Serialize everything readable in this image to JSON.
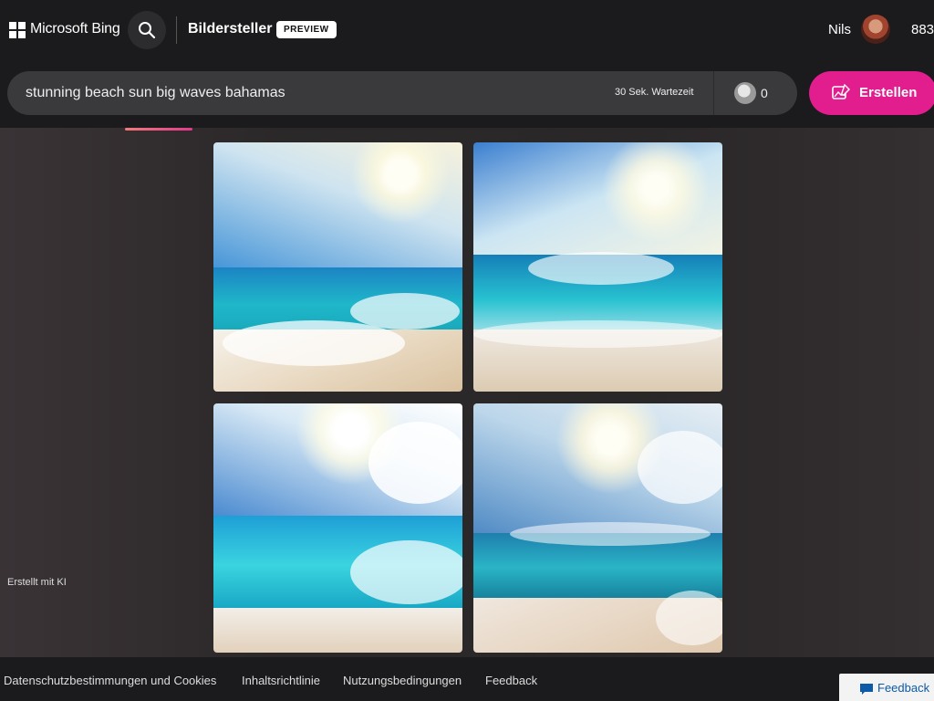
{
  "header": {
    "brand": "Microsoft Bing",
    "product": "Bildersteller",
    "badge": "PREVIEW",
    "user_name": "Nils",
    "points": "883"
  },
  "prompt_bar": {
    "query": "stunning beach sun big waves bahamas",
    "wait_text": "30 Sek. Wartezeit",
    "boost_count": "0",
    "create_label": "Erstellen"
  },
  "side": {
    "created_label": "Erstellt mit KI"
  },
  "images": [
    {
      "name": "generated-image-1"
    },
    {
      "name": "generated-image-2"
    },
    {
      "name": "generated-image-3"
    },
    {
      "name": "generated-image-4"
    }
  ],
  "footer": {
    "links": [
      "Datenschutzbestimmungen und Cookies",
      "Inhaltsrichtlinie",
      "Nutzungsbedingungen",
      "Feedback"
    ],
    "feedback_button": "Feedback"
  },
  "colors": {
    "accent": "#e21d8d",
    "header_bg": "#1b1a1c",
    "prompt_bg": "#3a393c"
  }
}
